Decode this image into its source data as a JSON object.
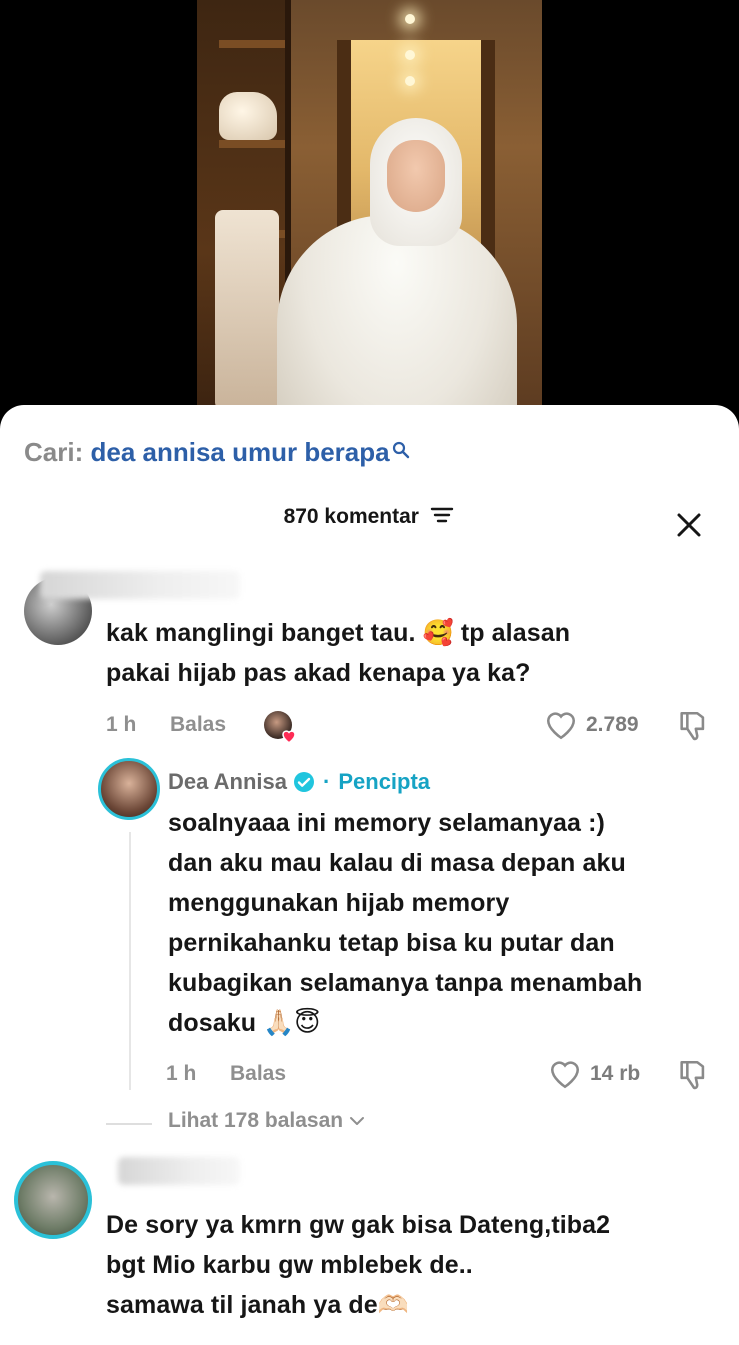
{
  "search": {
    "prefix": "Cari:",
    "query": "dea annisa umur berapa"
  },
  "header": {
    "count_label": "870 komentar"
  },
  "comments": [
    {
      "text_line1": "kak manglingi banget tau. 🥰 tp alasan",
      "text_line2": "pakai hijab pas akad kenapa ya ka?",
      "time": "1 h",
      "reply_label": "Balas",
      "likes": "2.789",
      "replies_label": "Lihat 178 balasan"
    },
    {
      "text_line1": "De sory ya kmrn gw gak bisa Dateng,tiba2",
      "text_line2": "bgt Mio karbu gw mblebek de..",
      "text_line3": "samawa til janah ya de🫶🏻"
    }
  ],
  "reply": {
    "author": "Dea Annisa",
    "separator": "·",
    "tag": "Pencipta",
    "lines": [
      "soalnyaaa ini memory selamanyaa :)",
      "dan aku mau kalau di masa depan aku",
      "menggunakan hijab memory",
      "pernikahanku tetap bisa ku putar dan",
      "kubagikan selamanya tanpa menambah",
      "dosaku 🙏🏻😇"
    ],
    "time": "1 h",
    "reply_label": "Balas",
    "likes": "14 rb"
  },
  "colors": {
    "accent_link": "#2d5fa8",
    "creator_tag": "#16a3c4",
    "heart": "#fe2c55"
  }
}
